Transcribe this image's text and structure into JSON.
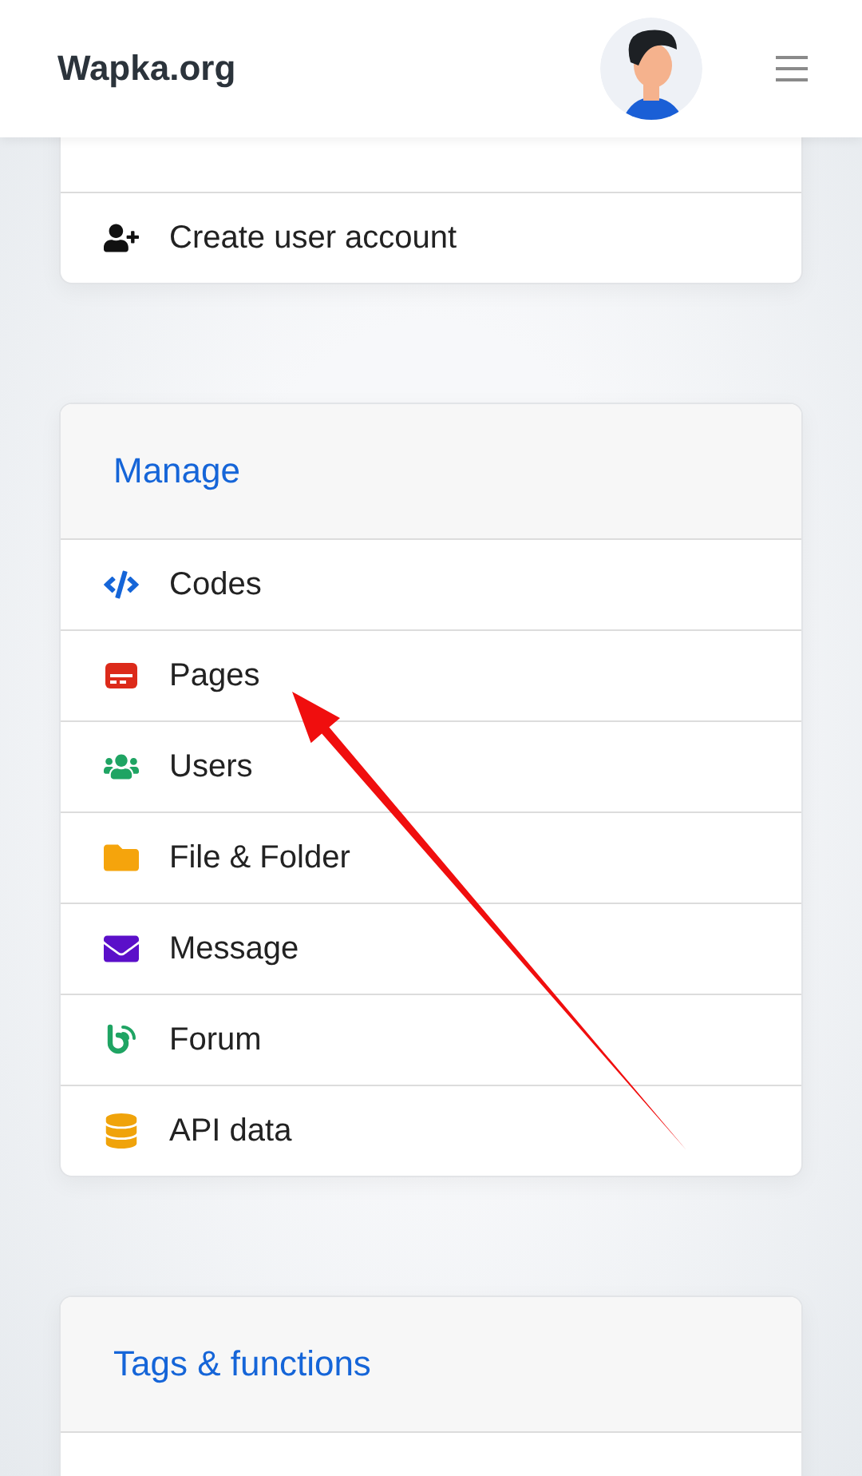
{
  "header": {
    "brand": "Wapka.org"
  },
  "cards": [
    {
      "items": [
        {
          "label": "Create user account",
          "kind": "user-plus",
          "color": "#111111"
        }
      ]
    },
    {
      "title": "Manage",
      "items": [
        {
          "label": "Codes",
          "kind": "code",
          "color": "#1565d8"
        },
        {
          "label": "Pages",
          "kind": "card",
          "color": "#dc2a1a"
        },
        {
          "label": "Users",
          "kind": "users",
          "color": "#1fa463"
        },
        {
          "label": "File & Folder",
          "kind": "folder",
          "color": "#f5a40c"
        },
        {
          "label": "Message",
          "kind": "envelope",
          "color": "#5b0fc9"
        },
        {
          "label": "Forum",
          "kind": "blog",
          "color": "#1fa463"
        },
        {
          "label": "API data",
          "kind": "database",
          "color": "#f0a30a"
        }
      ]
    },
    {
      "title": "Tags & functions"
    }
  ]
}
